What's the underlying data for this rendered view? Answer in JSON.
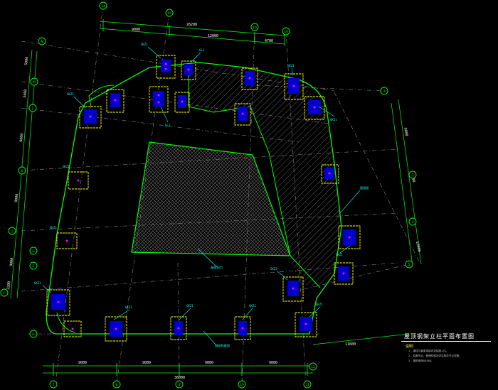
{
  "dimensions": {
    "top_overall": "26200",
    "top_1": "9000",
    "top_2": "12000",
    "top_3": "4700",
    "bottom_overall": "36000",
    "bottom_1": "9000",
    "bottom_2": "9000",
    "bottom_3": "9000",
    "bottom_4": "9000",
    "left_1": "5000",
    "left_2": "3400",
    "left_3": "9000",
    "left_4": "9000",
    "left_5": "9000",
    "left_6": "3200",
    "right_1": "9000",
    "right_2": "9000",
    "right_3": "12000",
    "bottom_right": "11600"
  },
  "grid_labels": {
    "top": [
      "14",
      "15",
      "16"
    ],
    "bottom": [
      "7",
      "8",
      "9",
      "10",
      "11",
      "12"
    ],
    "left": [
      "N",
      "M",
      "L",
      "K",
      "J",
      "H",
      "G",
      "E",
      "F",
      "D"
    ],
    "right": [
      "2",
      "3",
      "4",
      "5"
    ]
  },
  "element_tags": {
    "steel_column": "GKZ1",
    "steel_beam": "GL1"
  },
  "callouts": {
    "hatch_zone": "屋面板",
    "void_zone": "屋面洞口",
    "note_zone": "钢结构屋面"
  },
  "title_block": {
    "title": "屋顶钢架立柱平面布置图",
    "notes_heading": "说明：",
    "notes": [
      "1. 钢柱与钢梁连接详见结施—XX。",
      "2. 柱脚节点、预埋件做法详见相关节点详图。",
      "3. 钢材采用Q345B。"
    ]
  },
  "colors": {
    "background": "#000000",
    "wall_outline": "#00ff00",
    "axis_lines": "#9a9a9a",
    "column_boxes": "#ffff00",
    "steel_section": "#0000ff",
    "markers": "#ff00ff",
    "labels": "#00ffff",
    "grid_bubbles": "#00ff00"
  }
}
